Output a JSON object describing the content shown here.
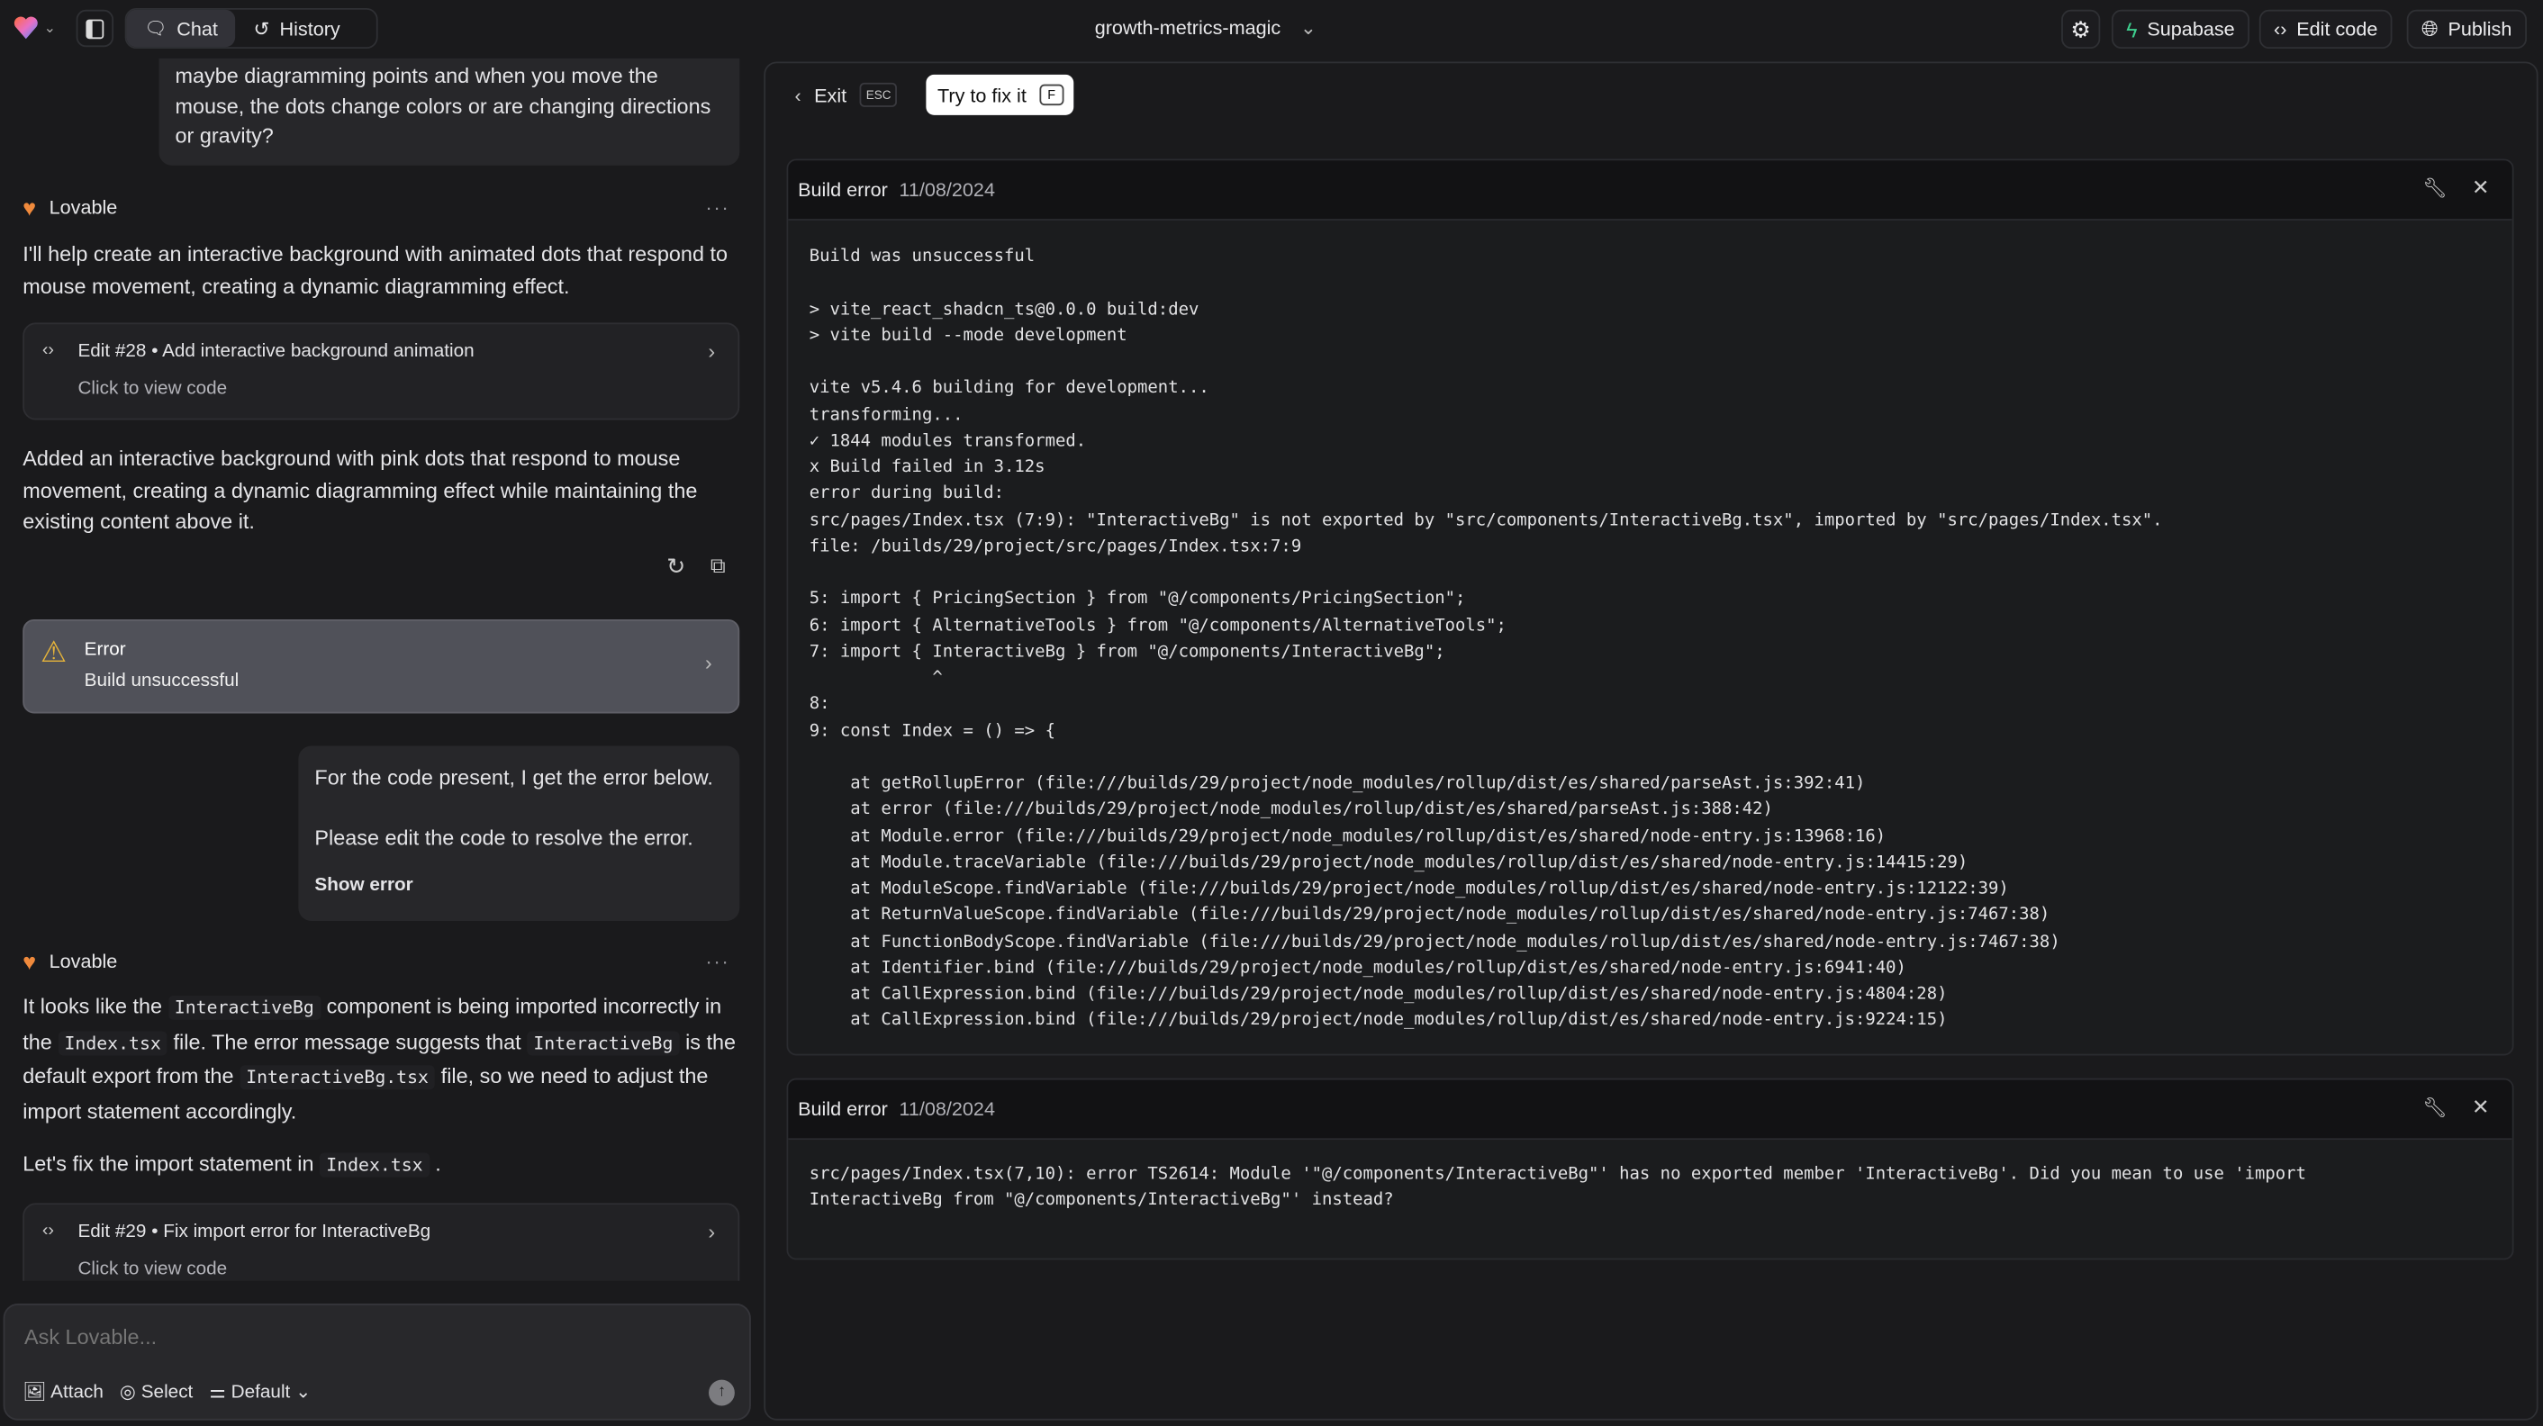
{
  "topbar": {
    "tabs": [
      {
        "label": "Chat",
        "icon": "chat-icon",
        "active": true
      },
      {
        "label": "History",
        "icon": "history-icon",
        "active": false
      }
    ],
    "project_name": "growth-metrics-magic",
    "buttons": {
      "supabase": "Supabase",
      "edit_code": "Edit code",
      "publish": "Publish"
    },
    "colors": {
      "supabase": "#3ecf8e"
    }
  },
  "chat": {
    "user_msg_1": "maybe diagramming points and when you move the mouse, the dots change colors or are changing directions or gravity?",
    "assistant_name": "Lovable",
    "more": "···",
    "reply_1": "I'll help create an interactive background with animated dots that respond to mouse movement, creating a dynamic diagramming effect.",
    "edit_1": {
      "title": "Edit #28 • Add interactive background animation",
      "subtitle": "Click to view code"
    },
    "reply_1b": "Added an interactive background with pink dots that respond to mouse movement, creating a dynamic diagramming effect while maintaining the existing content above it.",
    "error_card": {
      "title": "Error",
      "subtitle": "Build unsuccessful",
      "color": "#e5b33a"
    },
    "user_msg_2": {
      "line1": "For the code present, I get the error below.",
      "line2": "Please edit the code to resolve the error.",
      "link": "Show error"
    },
    "reply_2": [
      {
        "t": "It looks like the "
      },
      {
        "t": "InteractiveBg",
        "code": true
      },
      {
        "t": " component is being imported incorrectly in the "
      },
      {
        "t": "Index.tsx",
        "code": true
      },
      {
        "t": " file. The error message suggests that "
      },
      {
        "t": "InteractiveBg",
        "code": true
      },
      {
        "t": " is the default export from the "
      },
      {
        "t": "InteractiveBg.tsx",
        "code": true
      },
      {
        "t": " file, so we need to adjust the import statement accordingly."
      }
    ],
    "reply_3": [
      {
        "t": "Let's fix the import statement in "
      },
      {
        "t": "Index.tsx",
        "code": true
      },
      {
        "t": " ."
      }
    ],
    "edit_2": {
      "title": "Edit #29 • Fix import error for InteractiveBg",
      "subtitle": "Click to view code"
    },
    "input": {
      "placeholder": "Ask Lovable...",
      "attach": "Attach",
      "select": "Select",
      "mode": "Default"
    }
  },
  "errors_view": {
    "exit": "Exit",
    "exit_key": "ESC",
    "fix": "Try to fix it",
    "fix_key": "F",
    "panels": [
      {
        "title": "Build error",
        "date": "11/08/2024",
        "lines": [
          "Build was unsuccessful",
          "",
          "> vite_react_shadcn_ts@0.0.0 build:dev",
          "> vite build --mode development",
          "",
          "vite v5.4.6 building for development...",
          "transforming...",
          "✓ 1844 modules transformed.",
          "x Build failed in 3.12s",
          "error during build:",
          "src/pages/Index.tsx (7:9): \"InteractiveBg\" is not exported by \"src/components/InteractiveBg.tsx\", imported by \"src/pages/Index.tsx\".",
          "file: /builds/29/project/src/pages/Index.tsx:7:9",
          "",
          "5: import { PricingSection } from \"@/components/PricingSection\";",
          "6: import { AlternativeTools } from \"@/components/AlternativeTools\";",
          "7: import { InteractiveBg } from \"@/components/InteractiveBg\";",
          "            ^",
          "8: ",
          "9: const Index = () => {",
          "",
          "    at getRollupError (file:///builds/29/project/node_modules/rollup/dist/es/shared/parseAst.js:392:41)",
          "    at error (file:///builds/29/project/node_modules/rollup/dist/es/shared/parseAst.js:388:42)",
          "    at Module.error (file:///builds/29/project/node_modules/rollup/dist/es/shared/node-entry.js:13968:16)",
          "    at Module.traceVariable (file:///builds/29/project/node_modules/rollup/dist/es/shared/node-entry.js:14415:29)",
          "    at ModuleScope.findVariable (file:///builds/29/project/node_modules/rollup/dist/es/shared/node-entry.js:12122:39)",
          "    at ReturnValueScope.findVariable (file:///builds/29/project/node_modules/rollup/dist/es/shared/node-entry.js:7467:38)",
          "    at FunctionBodyScope.findVariable (file:///builds/29/project/node_modules/rollup/dist/es/shared/node-entry.js:7467:38)",
          "    at Identifier.bind (file:///builds/29/project/node_modules/rollup/dist/es/shared/node-entry.js:6941:40)",
          "    at CallExpression.bind (file:///builds/29/project/node_modules/rollup/dist/es/shared/node-entry.js:4804:28)",
          "    at CallExpression.bind (file:///builds/29/project/node_modules/rollup/dist/es/shared/node-entry.js:9224:15)"
        ]
      },
      {
        "title": "Build error",
        "date": "11/08/2024",
        "lines": [
          "src/pages/Index.tsx(7,10): error TS2614: Module '\"@/components/InteractiveBg\"' has no exported member 'InteractiveBg'. Did you mean to use 'import",
          "InteractiveBg from \"@/components/InteractiveBg\"' instead?"
        ]
      }
    ]
  }
}
